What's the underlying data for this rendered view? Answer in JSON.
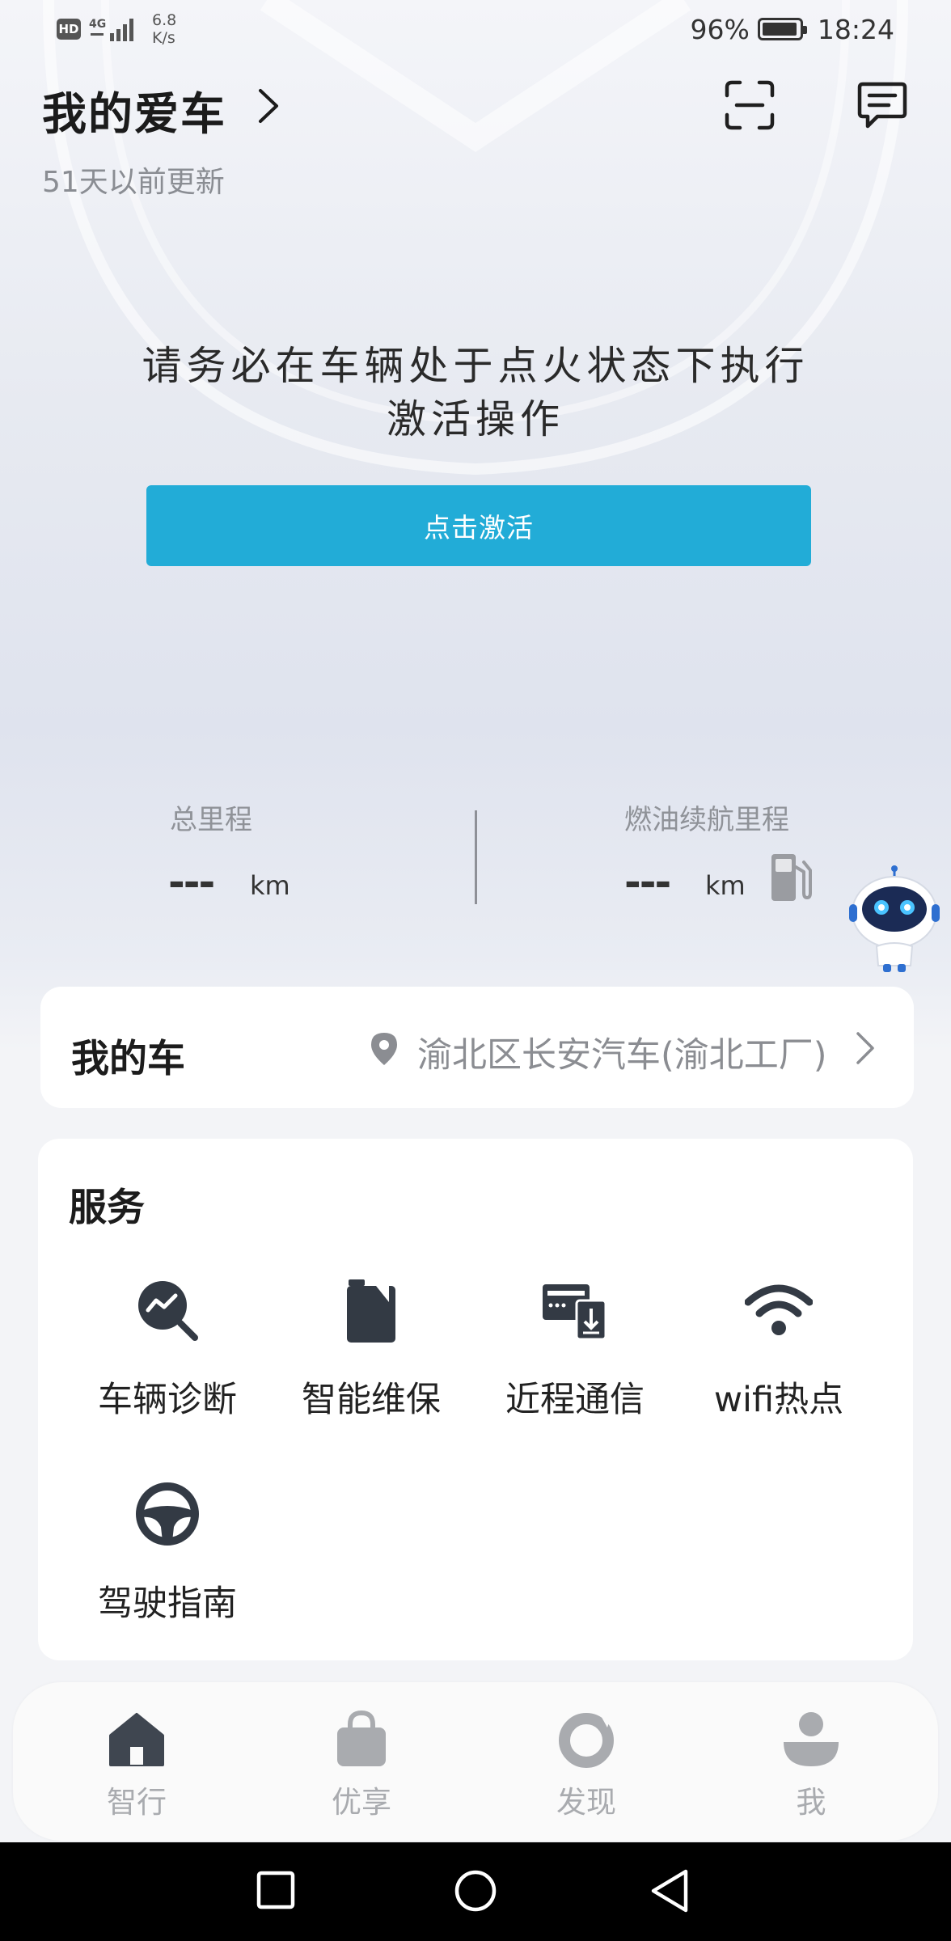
{
  "status_bar": {
    "hd": "HD",
    "network": "4G",
    "speed_value": "6.8",
    "speed_unit": "K/s",
    "battery": "96%",
    "battery_level": 0.96,
    "time": "18:24"
  },
  "header": {
    "title": "我的爱车",
    "updated": "51天以前更新"
  },
  "activation": {
    "message": "请务必在车辆处于点火状态下执行激活操作",
    "button_label": "点击激活"
  },
  "mileage": {
    "total_label": "总里程",
    "total_value": "---",
    "total_unit": "km",
    "range_label": "燃油续航里程",
    "range_value": "---",
    "range_unit": "km"
  },
  "my_car": {
    "title": "我的车",
    "location": "渝北区长安汽车(渝北工厂)"
  },
  "services": {
    "title": "服务",
    "items": [
      {
        "label": "车辆诊断",
        "icon": "diagnostics-icon"
      },
      {
        "label": "智能维保",
        "icon": "maintenance-icon"
      },
      {
        "label": "近程通信",
        "icon": "near-field-comm-icon"
      },
      {
        "label": "wifi热点",
        "icon": "wifi-icon"
      },
      {
        "label": "驾驶指南",
        "icon": "steering-wheel-icon"
      }
    ]
  },
  "tabbar": {
    "items": [
      {
        "label": "智行",
        "icon": "home-icon",
        "active": true
      },
      {
        "label": "优享",
        "icon": "shopping-bag-icon",
        "active": false
      },
      {
        "label": "发现",
        "icon": "discover-icon",
        "active": false
      },
      {
        "label": "我",
        "icon": "profile-icon",
        "active": false
      }
    ]
  },
  "colors": {
    "accent": "#22acd7",
    "icon_dark": "#333a44",
    "tab_active": "#3f4650",
    "tab_inactive": "#a9abaf"
  }
}
